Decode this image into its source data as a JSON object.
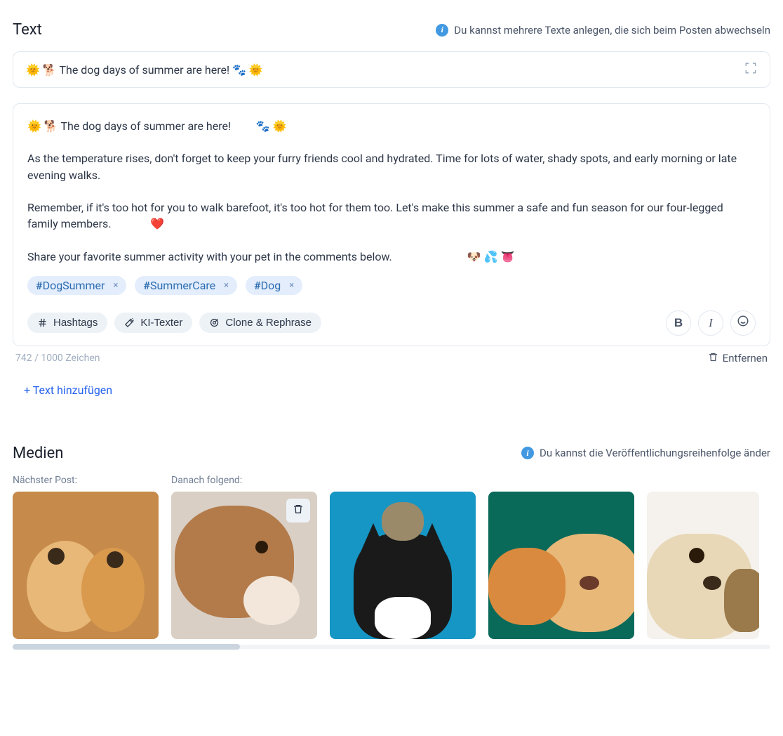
{
  "text_section": {
    "title": "Text",
    "info": "Du kannst mehrere Texte anlegen, die sich beim Posten abwechseln",
    "collapsed_summary": "🌞 🐕 The dog days of summer are here!         🐾 🌞",
    "expanded_body": "🌞 🐕 The dog days of summer are here!         🐾 🌞\n\nAs the temperature rises, don't forget to keep your furry friends cool and hydrated. Time for lots of water, shady spots, and early morning or late evening walks.\n\nRemember, if it's too hot for you to walk barefoot, it's too hot for them too. Let's make this summer a safe and fun season for our four-legged family members.              ❤️\n\nShare your favorite summer activity with your pet in the comments below.                           🐶 💦 👅",
    "hashtags": [
      "DogSummer",
      "SummerCare",
      "Dog"
    ],
    "toolbar": {
      "hashtags": "Hashtags",
      "ai_texter": "KI-Texter",
      "clone": "Clone & Rephrase",
      "bold": "B",
      "italic": "I"
    },
    "char_counter": "742 / 1000 Zeichen",
    "remove_label": "Entfernen",
    "add_text_label": "+ Text hinzufügen"
  },
  "media_section": {
    "title": "Medien",
    "info": "Du kannst die Veröffentlichungsreihenfolge änder",
    "next_label": "Nächster Post:",
    "following_label": "Danach folgend:"
  }
}
